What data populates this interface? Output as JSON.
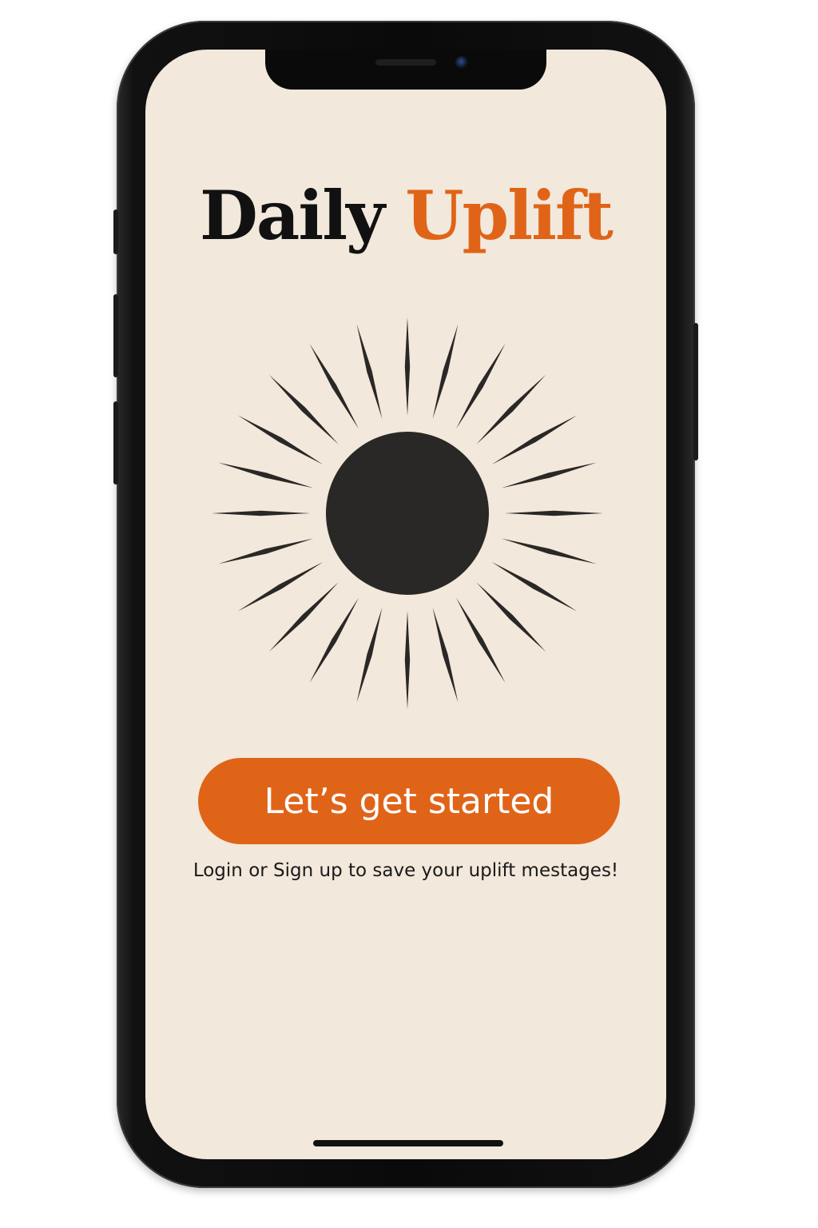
{
  "app": {
    "title_part1": "Daily",
    "title_part2": "Uplift"
  },
  "colors": {
    "background": "#f2e8db",
    "accent": "#e06418",
    "ink": "#111111",
    "sun": "#2a2826"
  },
  "illustration": {
    "icon": "sun-icon",
    "ray_count": 24
  },
  "cta": {
    "label": "Let’s get started"
  },
  "subtext": "Login or Sign up to save your uplift mestages!"
}
